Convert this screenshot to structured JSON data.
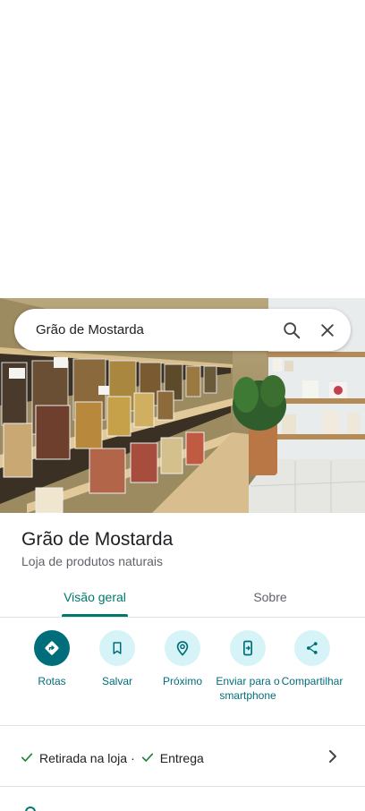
{
  "search": {
    "query": "Grão de Mostarda"
  },
  "place": {
    "name": "Grão de Mostarda",
    "category": "Loja de produtos naturais"
  },
  "tabs": [
    {
      "label": "Visão geral",
      "active": true
    },
    {
      "label": "Sobre",
      "active": false
    }
  ],
  "actions": [
    {
      "label": "Rotas",
      "icon": "directions-icon"
    },
    {
      "label": "Salvar",
      "icon": "bookmark-icon"
    },
    {
      "label": "Próximo",
      "icon": "nearby-icon"
    },
    {
      "label": "Enviar para o smartphone",
      "icon": "send-to-phone-icon"
    },
    {
      "label": "Compartilhar",
      "icon": "share-icon"
    }
  ],
  "services": {
    "pickup": "Retirada na loja",
    "separator": "·",
    "delivery": "Entrega"
  },
  "colors": {
    "accent": "#006e7a",
    "tab_accent": "#00796b",
    "check": "#188038",
    "action_bg": "#d6f4f7"
  }
}
